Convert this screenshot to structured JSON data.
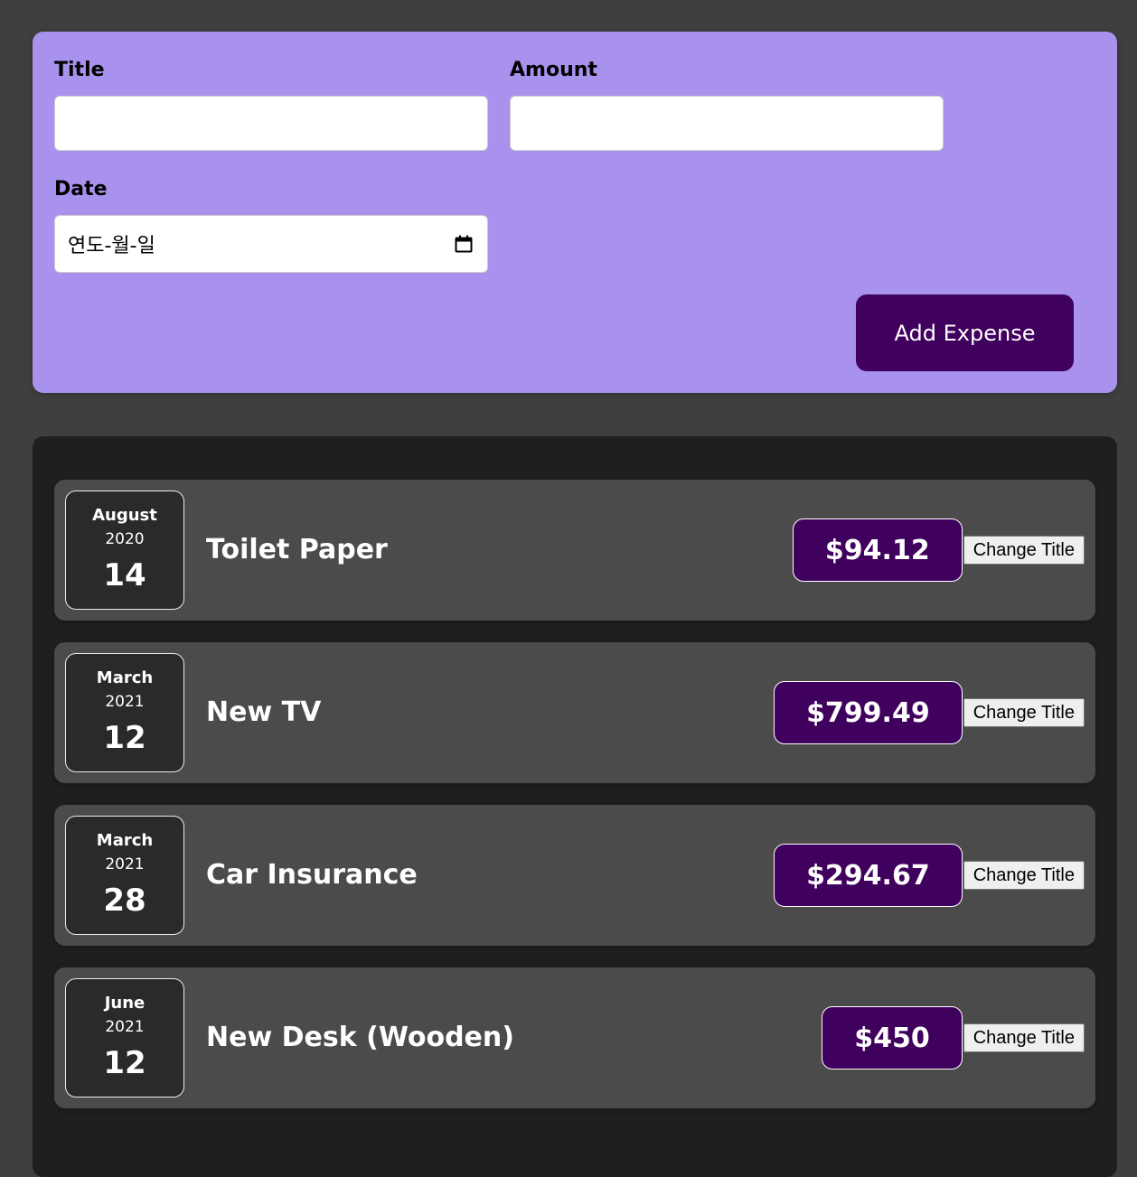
{
  "form": {
    "title_label": "Title",
    "title_value": "",
    "amount_label": "Amount",
    "amount_value": "",
    "date_label": "Date",
    "date_placeholder": "연도-월-일",
    "submit_label": "Add Expense"
  },
  "expenses": [
    {
      "month": "August",
      "year": "2020",
      "day": "14",
      "title": "Toilet Paper",
      "amount": "$94.12",
      "action_label": "Change Title"
    },
    {
      "month": "March",
      "year": "2021",
      "day": "12",
      "title": "New TV",
      "amount": "$799.49",
      "action_label": "Change Title"
    },
    {
      "month": "March",
      "year": "2021",
      "day": "28",
      "title": "Car Insurance",
      "amount": "$294.67",
      "action_label": "Change Title"
    },
    {
      "month": "June",
      "year": "2021",
      "day": "12",
      "title": "New Desk (Wooden)",
      "amount": "$450",
      "action_label": "Change Title"
    }
  ],
  "colors": {
    "page_background": "#3f3f3f",
    "form_background": "#a892ee",
    "list_background": "#1f1f1f",
    "item_background": "#4b4b4b",
    "accent": "#40005d"
  },
  "icons": {
    "date_picker": "calendar-icon"
  }
}
